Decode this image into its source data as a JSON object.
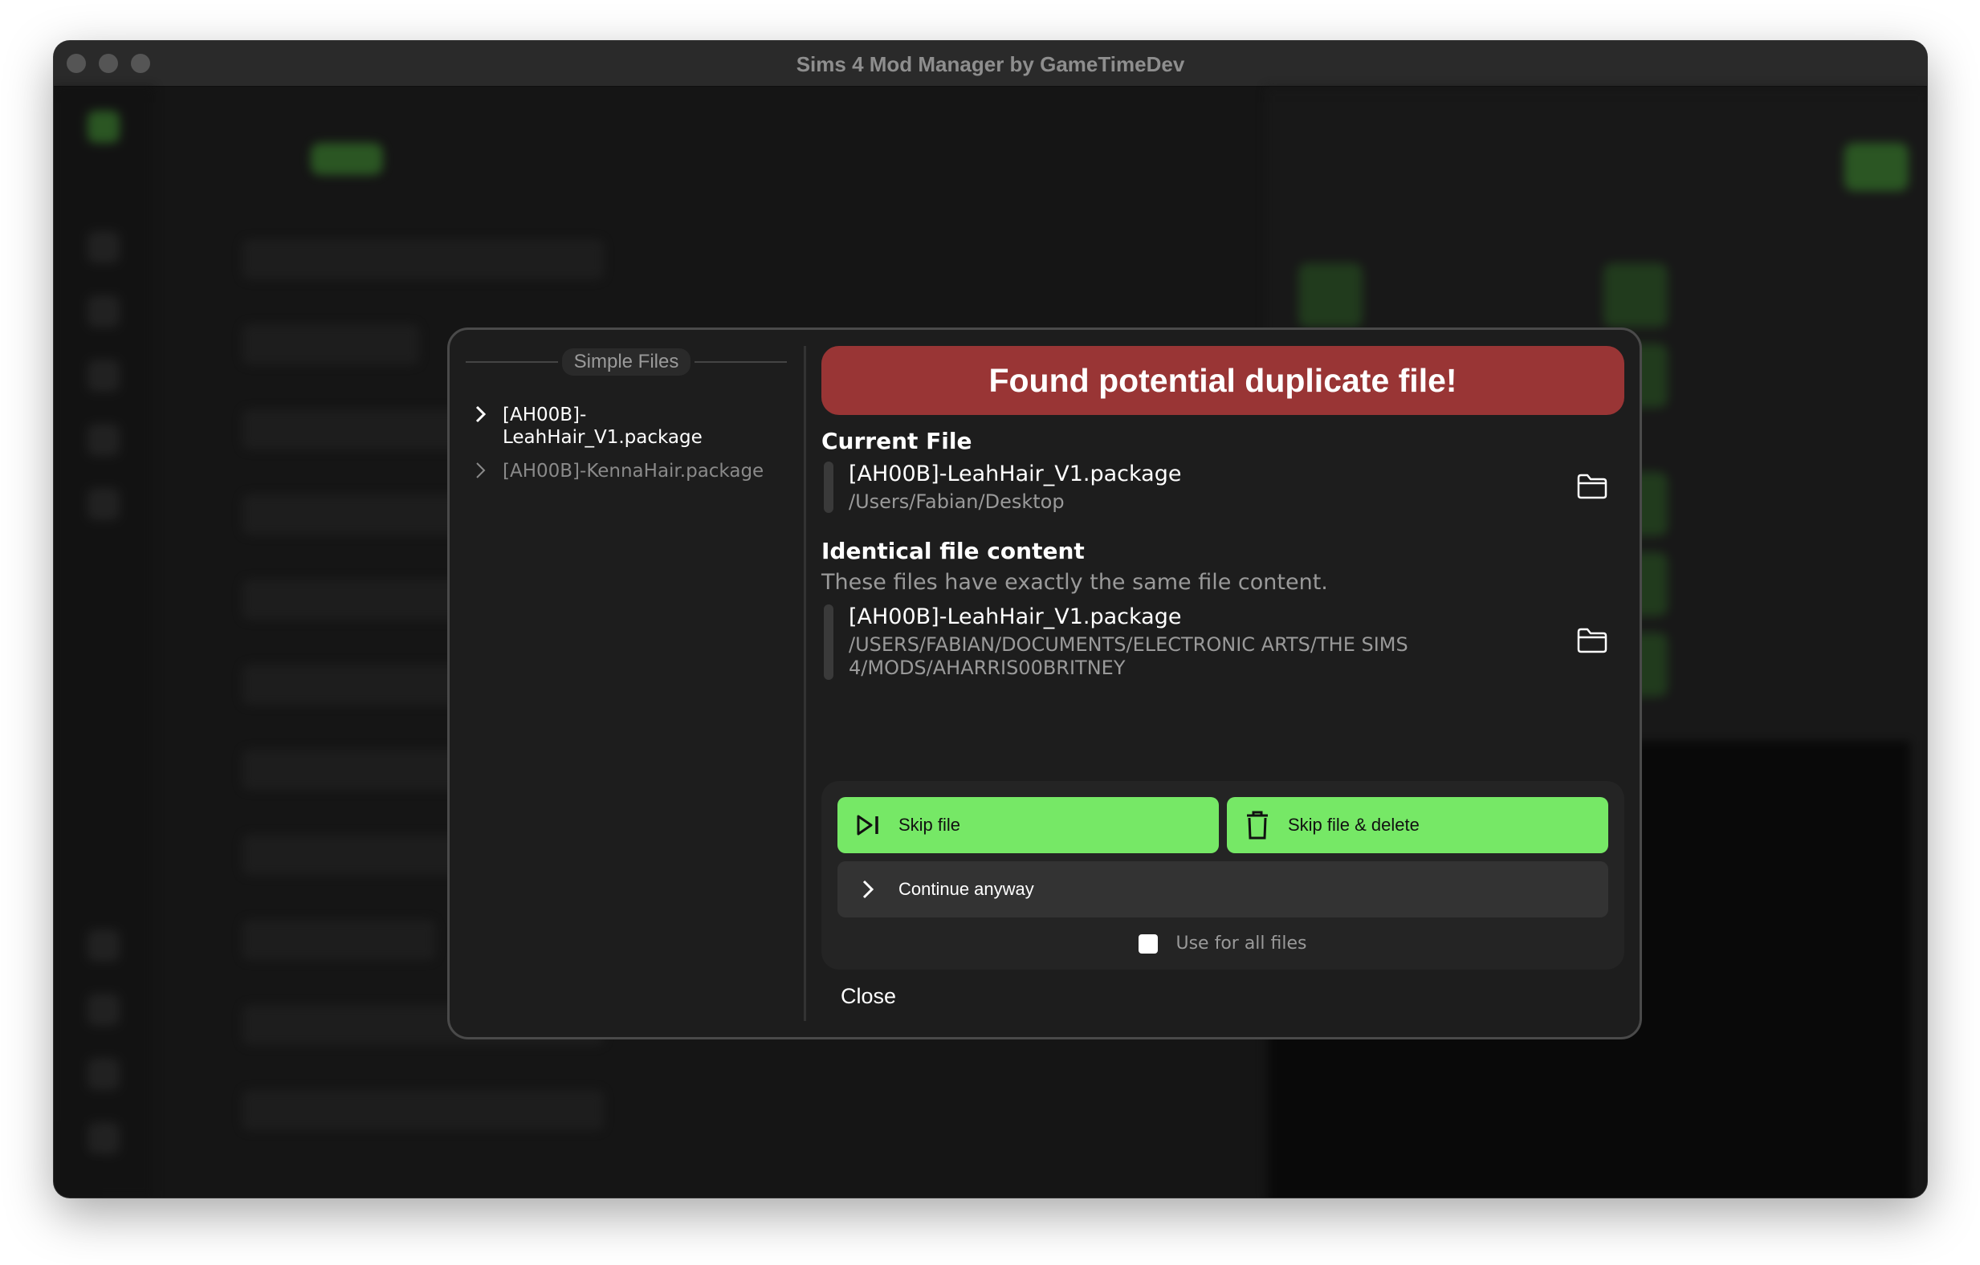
{
  "window": {
    "title": "Sims 4 Mod Manager by GameTimeDev"
  },
  "files_panel": {
    "header": "Simple Files",
    "items": [
      {
        "name": "[AH00B]-LeahHair_V1.package",
        "line1": "[AH00B]-",
        "line2": "LeahHair_V1.package",
        "active": true
      },
      {
        "name": "[AH00B]-KennaHair.package",
        "active": false
      }
    ]
  },
  "banner": {
    "text": "Found potential duplicate file!",
    "color": "#993535"
  },
  "current_file": {
    "title": "Current File",
    "name": "[AH00B]-LeahHair_V1.package",
    "path": "/Users/Fabian/Desktop",
    "icon": "folder-icon"
  },
  "identical": {
    "title": "Identical file content",
    "subtitle": "These files have exactly the same file content.",
    "name": "[AH00B]-LeahHair_V1.package",
    "path_line1": "/USERS/FABIAN/DOCUMENTS/ELECTRONIC ARTS/THE SIMS",
    "path_line2": "4/MODS/AHARRIS00BRITNEY",
    "icon": "folder-icon"
  },
  "actions": {
    "skip_label": "Skip file",
    "skip_delete_label": "Skip file & delete",
    "continue_label": "Continue anyway",
    "use_all_label": "Use for all files",
    "use_all_checked": false,
    "accent": "#76e866"
  },
  "close_label": "Close"
}
